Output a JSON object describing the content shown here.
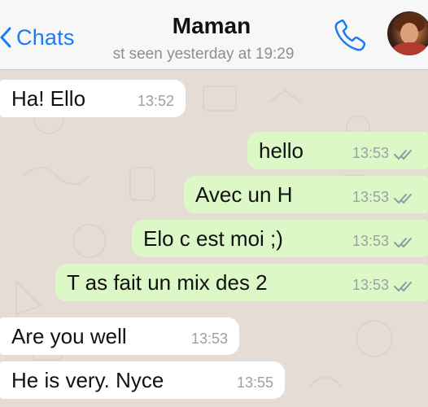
{
  "header": {
    "back_label": "Chats",
    "title": "Maman",
    "subtitle": "st seen yesterday at 19:29"
  },
  "messages": [
    {
      "direction": "in",
      "text": "Ha! Ello",
      "time": "13:52"
    },
    {
      "direction": "out",
      "text": "hello",
      "time": "13:53",
      "status": "read"
    },
    {
      "direction": "out",
      "text": "Avec un H",
      "time": "13:53",
      "status": "read"
    },
    {
      "direction": "out",
      "text": "Elo c est moi ;)",
      "time": "13:53",
      "status": "read"
    },
    {
      "direction": "out",
      "text": "T as fait un mix des 2",
      "time": "13:53",
      "status": "read"
    },
    {
      "direction": "in",
      "text": "Are you well",
      "time": "13:53"
    },
    {
      "direction": "in",
      "text": "He is very. Nyce",
      "time": "13:55"
    }
  ],
  "colors": {
    "accent": "#1a7cf5",
    "outgoing_bubble": "#dcf8c6",
    "incoming_bubble": "#ffffff",
    "chat_background": "#e5ddd5",
    "read_ticks": "#8e9aa0"
  },
  "icons": {
    "back": "chevron-left-icon",
    "call": "phone-icon",
    "read_status": "double-check-icon"
  }
}
